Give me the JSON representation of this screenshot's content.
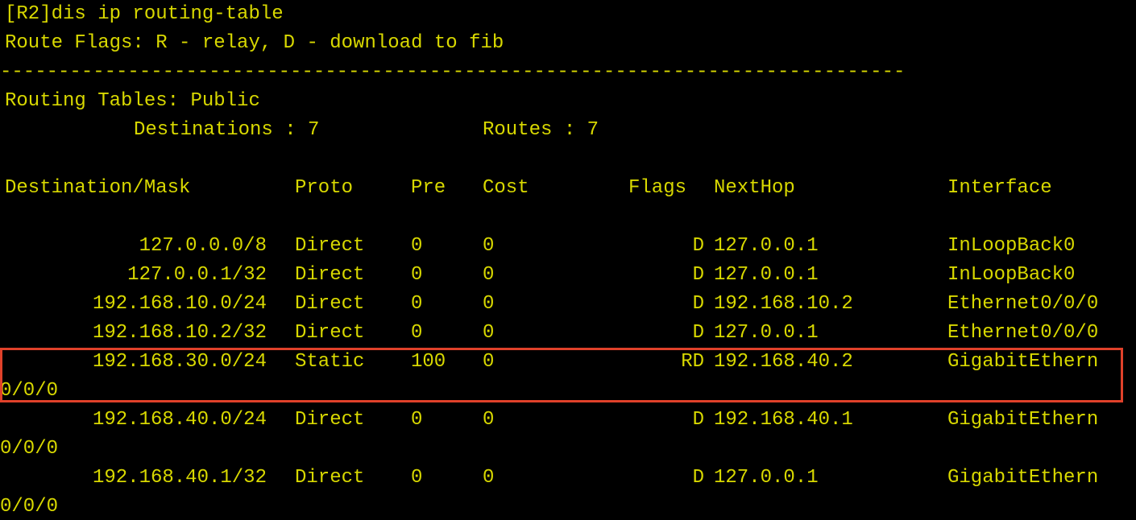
{
  "terminal": {
    "prompt_line": "[R2]dis ip routing-table",
    "flags_line": "Route Flags: R - relay, D - download to fib",
    "separator": "------------------------------------------------------------------------------",
    "tables_title": "Routing Tables: Public",
    "destinations_label": "Destinations : 7",
    "routes_label": "Routes : 7",
    "headers": {
      "destination": "Destination/Mask",
      "proto": "Proto",
      "pre": "Pre",
      "cost": "Cost",
      "flags": "Flags",
      "nexthop": "NextHop",
      "interface": "Interface"
    },
    "rows": [
      {
        "destination": "127.0.0.0/8",
        "proto": "Direct",
        "pre": "0",
        "cost": "0",
        "flags": "D",
        "nexthop": "127.0.0.1",
        "interface": "InLoopBack0",
        "wrap": ""
      },
      {
        "destination": "127.0.0.1/32",
        "proto": "Direct",
        "pre": "0",
        "cost": "0",
        "flags": "D",
        "nexthop": "127.0.0.1",
        "interface": "InLoopBack0",
        "wrap": ""
      },
      {
        "destination": "192.168.10.0/24",
        "proto": "Direct",
        "pre": "0",
        "cost": "0",
        "flags": "D",
        "nexthop": "192.168.10.2",
        "interface": "Ethernet0/0/0",
        "wrap": ""
      },
      {
        "destination": "192.168.10.2/32",
        "proto": "Direct",
        "pre": "0",
        "cost": "0",
        "flags": "D",
        "nexthop": "127.0.0.1",
        "interface": "Ethernet0/0/0",
        "wrap": ""
      },
      {
        "destination": "192.168.30.0/24",
        "proto": "Static",
        "pre": "100",
        "cost": "0",
        "flags": "RD",
        "nexthop": "192.168.40.2",
        "interface": "GigabitEthern",
        "wrap": "0/0/0"
      },
      {
        "destination": "192.168.40.0/24",
        "proto": "Direct",
        "pre": "0",
        "cost": "0",
        "flags": "D",
        "nexthop": "192.168.40.1",
        "interface": "GigabitEthern",
        "wrap": "0/0/0"
      },
      {
        "destination": "192.168.40.1/32",
        "proto": "Direct",
        "pre": "0",
        "cost": "0",
        "flags": "D",
        "nexthop": "127.0.0.1",
        "interface": "GigabitEthern",
        "wrap": "0/0/0"
      }
    ],
    "highlighted_row": 4
  },
  "colors": {
    "background": "#000000",
    "text": "#d8d800",
    "highlight_border": "#e0412a"
  }
}
